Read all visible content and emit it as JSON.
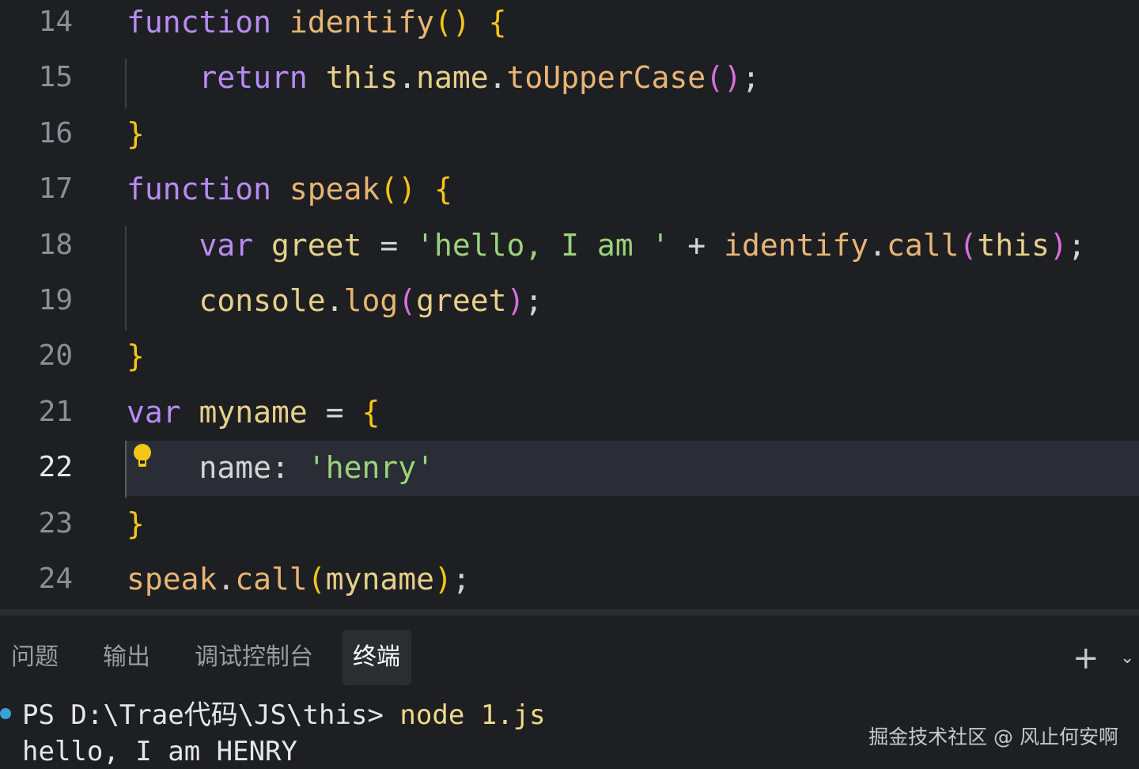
{
  "editor": {
    "current_line": "22",
    "lines": [
      {
        "num": "14",
        "tokens": [
          [
            "k",
            "function"
          ],
          [
            "sp",
            " "
          ],
          [
            "fn",
            "identify"
          ],
          [
            "by",
            "()"
          ],
          [
            "sp",
            " "
          ],
          [
            "by",
            "{"
          ]
        ]
      },
      {
        "num": "15",
        "tokens": [
          [
            "sp",
            "    "
          ],
          [
            "k",
            "return"
          ],
          [
            "sp",
            " "
          ],
          [
            "id",
            "this"
          ],
          [
            "p",
            "."
          ],
          [
            "id",
            "name"
          ],
          [
            "p",
            "."
          ],
          [
            "fn",
            "toUpperCase"
          ],
          [
            "bp",
            "()"
          ],
          [
            "p",
            ";"
          ]
        ]
      },
      {
        "num": "16",
        "tokens": [
          [
            "by",
            "}"
          ]
        ]
      },
      {
        "num": "17",
        "tokens": [
          [
            "k",
            "function"
          ],
          [
            "sp",
            " "
          ],
          [
            "fn",
            "speak"
          ],
          [
            "by",
            "()"
          ],
          [
            "sp",
            " "
          ],
          [
            "by",
            "{"
          ]
        ]
      },
      {
        "num": "18",
        "tokens": [
          [
            "sp",
            "    "
          ],
          [
            "k",
            "var"
          ],
          [
            "sp",
            " "
          ],
          [
            "id",
            "greet"
          ],
          [
            "sp",
            " "
          ],
          [
            "op",
            "="
          ],
          [
            "sp",
            " "
          ],
          [
            "s",
            "'hello, I am '"
          ],
          [
            "sp",
            " "
          ],
          [
            "op",
            "+"
          ],
          [
            "sp",
            " "
          ],
          [
            "fn",
            "identify"
          ],
          [
            "p",
            "."
          ],
          [
            "fn",
            "call"
          ],
          [
            "bp",
            "("
          ],
          [
            "id",
            "this"
          ],
          [
            "bp",
            ")"
          ],
          [
            "p",
            ";"
          ]
        ]
      },
      {
        "num": "19",
        "tokens": [
          [
            "sp",
            "    "
          ],
          [
            "id",
            "console"
          ],
          [
            "p",
            "."
          ],
          [
            "fn",
            "log"
          ],
          [
            "bp",
            "("
          ],
          [
            "id",
            "greet"
          ],
          [
            "bp",
            ")"
          ],
          [
            "p",
            ";"
          ]
        ]
      },
      {
        "num": "20",
        "tokens": [
          [
            "by",
            "}"
          ]
        ]
      },
      {
        "num": "21",
        "tokens": [
          [
            "k",
            "var"
          ],
          [
            "sp",
            " "
          ],
          [
            "id",
            "myname"
          ],
          [
            "sp",
            " "
          ],
          [
            "op",
            "="
          ],
          [
            "sp",
            " "
          ],
          [
            "by",
            "{"
          ]
        ]
      },
      {
        "num": "22",
        "tokens": [
          [
            "sp",
            "    "
          ],
          [
            "pr",
            "name"
          ],
          [
            "p",
            ":"
          ],
          [
            "sp",
            " "
          ],
          [
            "s",
            "'henry'"
          ]
        ]
      },
      {
        "num": "23",
        "tokens": [
          [
            "by",
            "}"
          ]
        ]
      },
      {
        "num": "24",
        "tokens": [
          [
            "fn",
            "speak"
          ],
          [
            "p",
            "."
          ],
          [
            "fn",
            "call"
          ],
          [
            "by",
            "("
          ],
          [
            "id",
            "myname"
          ],
          [
            "by",
            ")"
          ],
          [
            "p",
            ";"
          ]
        ]
      }
    ]
  },
  "panel": {
    "tabs": [
      {
        "label": "问题",
        "active": false
      },
      {
        "label": "输出",
        "active": false
      },
      {
        "label": "调试控制台",
        "active": false
      },
      {
        "label": "终端",
        "active": true
      }
    ],
    "add_icon": "plus-icon",
    "dropdown_icon": "chevron-down-icon"
  },
  "terminal": {
    "prompt": "PS D:\\Trae代码\\JS\\this> ",
    "command": "node 1.js",
    "output": "hello, I am HENRY"
  },
  "watermark": "掘金技术社区 @ 风止何安啊",
  "colors": {
    "background": "#1e1f22",
    "keyword": "#b78cf2",
    "function": "#e7b574",
    "identifier": "#e6d08a",
    "string": "#9bd37b",
    "bracket_yellow": "#f5c518",
    "bracket_purple": "#d96ee0",
    "current_line": "#2a2d35"
  }
}
